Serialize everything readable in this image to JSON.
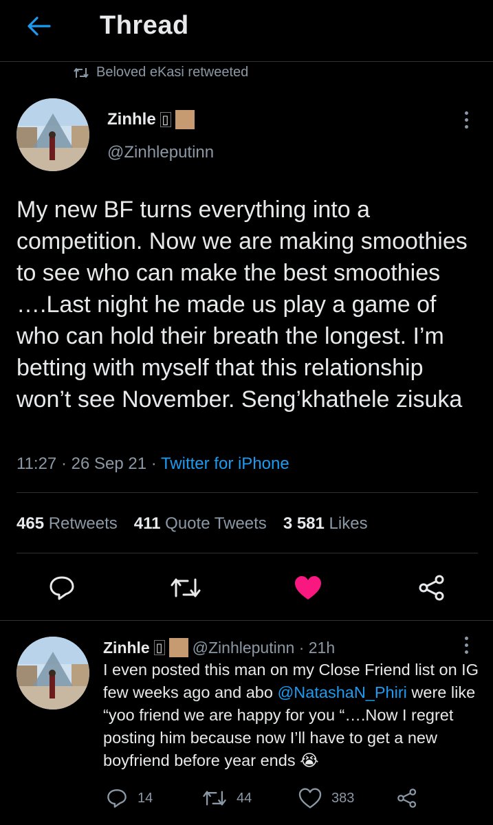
{
  "header": {
    "title": "Thread"
  },
  "retweet_banner": {
    "text": "Beloved eKasi retweeted"
  },
  "tweet": {
    "author_name": "Zinhle",
    "name_glyph": "▯",
    "handle": "@Zinhleputinn",
    "text": "My new BF turns everything into a competition. Now we are making smoothies to see who can make the best smoothies ….Last night he made us play a game of who can hold their breath the longest. I’m betting with myself that this relationship won’t see November. Seng’khathele zisuka",
    "time": "11:27",
    "date": "26 Sep 21",
    "source": "Twitter for iPhone",
    "stats": {
      "retweets_count": "465",
      "retweets_label": "Retweets",
      "quotes_count": "411",
      "quotes_label": "Quote Tweets",
      "likes_count": "3 581",
      "likes_label": "Likes"
    },
    "liked_color": "#f91880"
  },
  "reply": {
    "author_name": "Zinhle",
    "name_glyph": "▯",
    "handle_time": "@Zinhleputinn · 21h",
    "text_before": "I even posted this man on my Close Friend list on IG few weeks ago and abo ",
    "mention": "@NatashaN_Phiri",
    "text_after": " were like “yoo friend we are happy for you “….Now I regret posting him because now I’ll have to get a new boyfriend before year ends",
    "emoji": "😭",
    "counts": {
      "replies": "14",
      "retweets": "44",
      "likes": "383"
    }
  },
  "icons": {
    "back": "arrow-left-icon",
    "retweet": "retweet-icon",
    "reply": "reply-icon",
    "like": "heart-icon",
    "share": "share-icon",
    "more": "more-vertical-icon"
  },
  "colors": {
    "accent": "#1d9bf0",
    "background": "#000000",
    "secondary_text": "#8b98a5"
  }
}
